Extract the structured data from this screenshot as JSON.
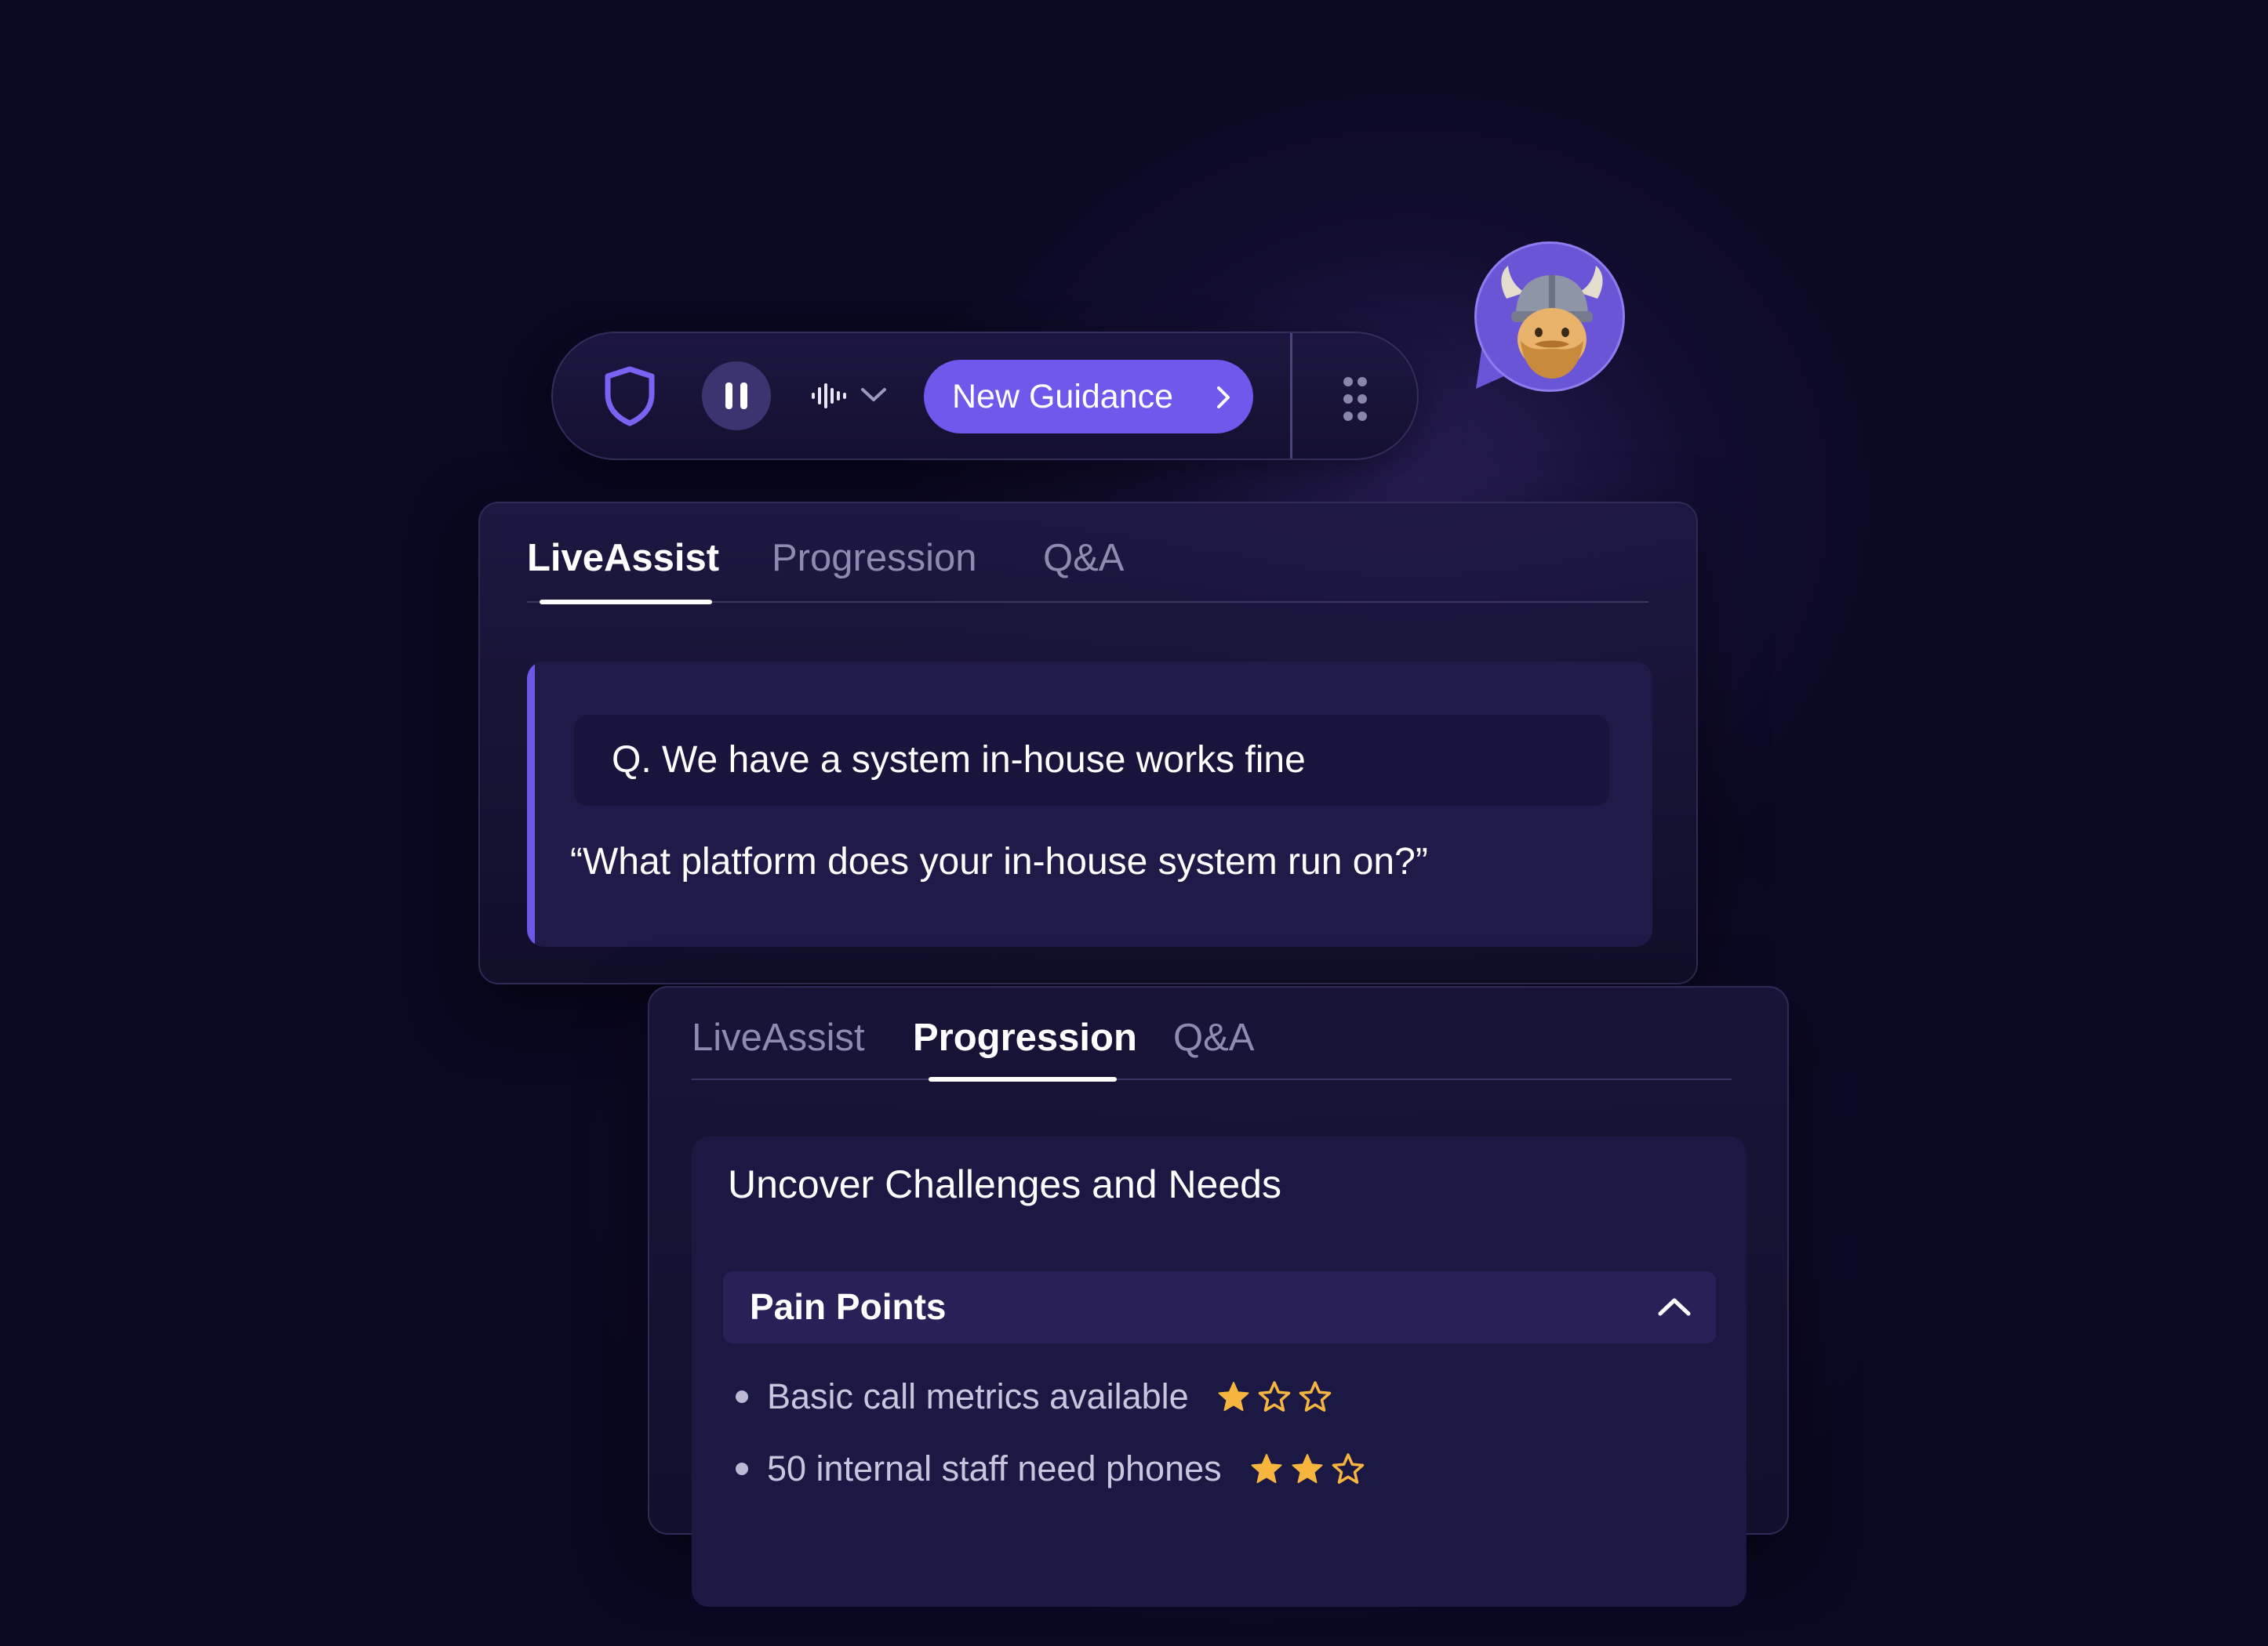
{
  "colors": {
    "background": "#0a0822",
    "accent": "#7058ec",
    "star_filled": "#f5b53f",
    "star_empty": "#f5b53f"
  },
  "toolbar": {
    "shield_icon": "shield-icon",
    "pause_icon": "pause-icon",
    "audio_icon": "audio-waveform-icon",
    "guidance_label": "New Guidance",
    "grip_icon": "drag-grip-icon"
  },
  "avatar": {
    "icon": "viking-avatar"
  },
  "panel_liveassist": {
    "tabs": [
      "LiveAssist",
      "Progression",
      "Q&A"
    ],
    "active_tab": "LiveAssist",
    "question": "Q. We have a system in-house works fine",
    "answer": "“What platform does your in-house system run on?”"
  },
  "panel_progression": {
    "tabs": [
      "LiveAssist",
      "Progression",
      "Q&A"
    ],
    "active_tab": "Progression",
    "section_title": "Uncover Challenges and Needs",
    "group_title": "Pain Points",
    "items": [
      {
        "label": "Basic call metrics available",
        "rating": 1,
        "max": 3
      },
      {
        "label": "50 internal staff need phones",
        "rating": 2,
        "max": 3
      }
    ]
  }
}
